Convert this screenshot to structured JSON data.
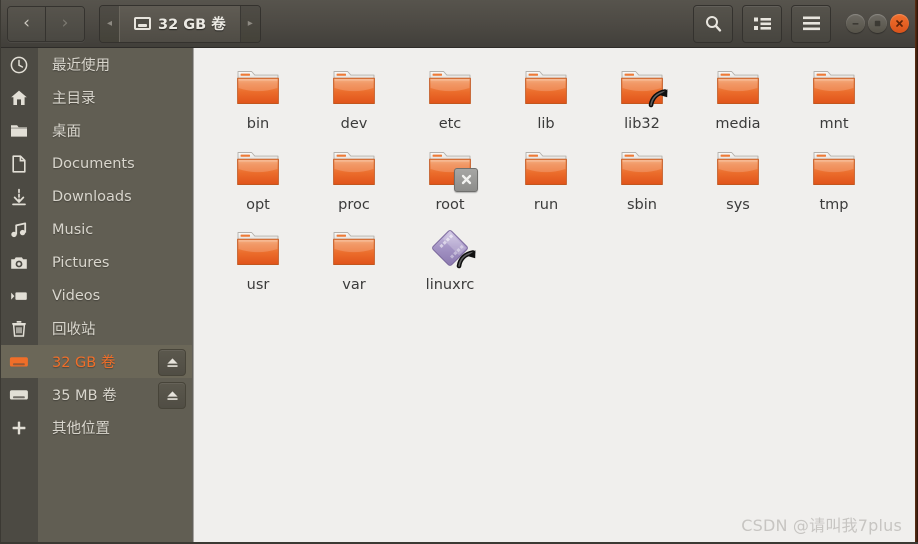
{
  "window": {
    "title": "32 GB 卷",
    "accent_color": "#ef6e29",
    "headerbar_color": "#4d4a44",
    "sidebar_color": "#615e53",
    "content_color": "#f0efed"
  },
  "headerbar": {
    "back_label": "‹",
    "forward_label": "›",
    "path_prev_label": "◂",
    "path_next_label": "▸",
    "breadcrumb": {
      "icon": "drive-harddisk-icon",
      "label": "32 GB 卷"
    },
    "buttons": [
      {
        "name": "search-button",
        "icon": "search-icon",
        "label": ""
      },
      {
        "name": "view-toggle-button",
        "icon": "list-view-icon",
        "label": ""
      },
      {
        "name": "menu-button",
        "icon": "hamburger-menu-icon",
        "label": ""
      }
    ],
    "window_controls": [
      {
        "name": "minimize-button",
        "icon": "minimize-icon"
      },
      {
        "name": "maximize-button",
        "icon": "maximize-icon"
      },
      {
        "name": "close-button",
        "icon": "close-icon"
      }
    ]
  },
  "sidebar": {
    "items": [
      {
        "label": "最近使用",
        "icon": "clock-icon",
        "selected": false,
        "eject": false
      },
      {
        "label": "主目录",
        "icon": "home-icon",
        "selected": false,
        "eject": false
      },
      {
        "label": "桌面",
        "icon": "folder-icon",
        "selected": false,
        "eject": false
      },
      {
        "label": "Documents",
        "icon": "document-icon",
        "selected": false,
        "eject": false
      },
      {
        "label": "Downloads",
        "icon": "download-icon",
        "selected": false,
        "eject": false
      },
      {
        "label": "Music",
        "icon": "music-icon",
        "selected": false,
        "eject": false
      },
      {
        "label": "Pictures",
        "icon": "camera-icon",
        "selected": false,
        "eject": false
      },
      {
        "label": "Videos",
        "icon": "video-icon",
        "selected": false,
        "eject": false
      },
      {
        "label": "回收站",
        "icon": "trash-icon",
        "selected": false,
        "eject": false
      },
      {
        "label": "32 GB 卷",
        "icon": "drive-icon",
        "selected": true,
        "eject": true
      },
      {
        "label": "35 MB 卷",
        "icon": "drive-icon",
        "selected": false,
        "eject": true
      },
      {
        "label": "其他位置",
        "icon": "plus-icon",
        "selected": false,
        "eject": false
      }
    ]
  },
  "main": {
    "items": [
      {
        "label": "bin",
        "type": "folder",
        "emblem": "none"
      },
      {
        "label": "dev",
        "type": "folder",
        "emblem": "none"
      },
      {
        "label": "etc",
        "type": "folder",
        "emblem": "none"
      },
      {
        "label": "lib",
        "type": "folder",
        "emblem": "none"
      },
      {
        "label": "lib32",
        "type": "folder",
        "emblem": "symlink"
      },
      {
        "label": "media",
        "type": "folder",
        "emblem": "none"
      },
      {
        "label": "mnt",
        "type": "folder",
        "emblem": "none"
      },
      {
        "label": "opt",
        "type": "folder",
        "emblem": "none"
      },
      {
        "label": "proc",
        "type": "folder",
        "emblem": "none"
      },
      {
        "label": "root",
        "type": "folder",
        "emblem": "unreadable"
      },
      {
        "label": "run",
        "type": "folder",
        "emblem": "none"
      },
      {
        "label": "sbin",
        "type": "folder",
        "emblem": "none"
      },
      {
        "label": "sys",
        "type": "folder",
        "emblem": "none"
      },
      {
        "label": "tmp",
        "type": "folder",
        "emblem": "none"
      },
      {
        "label": "usr",
        "type": "folder",
        "emblem": "none"
      },
      {
        "label": "var",
        "type": "folder",
        "emblem": "none"
      },
      {
        "label": "linuxrc",
        "type": "archive",
        "emblem": "symlink"
      }
    ]
  },
  "watermark": {
    "text": "CSDN @请叫我7plus"
  }
}
